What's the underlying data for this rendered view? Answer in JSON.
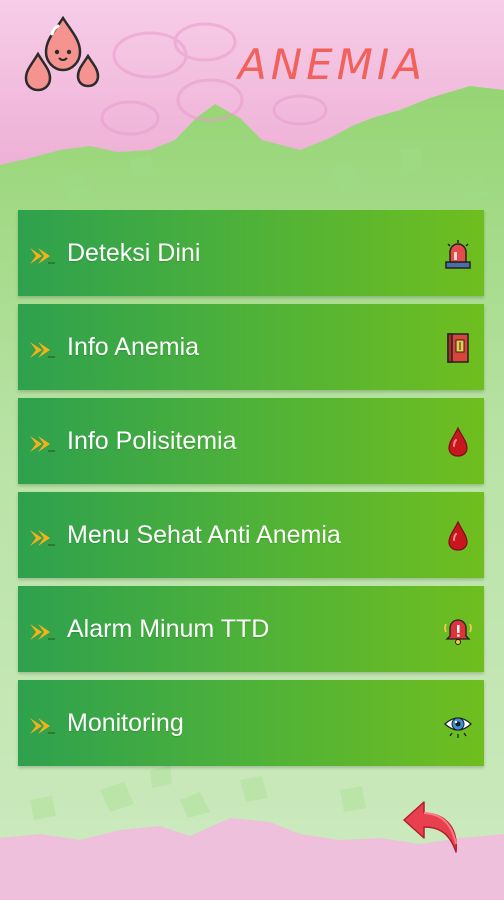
{
  "header": {
    "title": "ANEMIA",
    "logo_icon": "blood-drops-logo-icon"
  },
  "colors": {
    "title": "#f0625b",
    "header_pink": "#f2b6dc",
    "hill_green": "#8fd36a",
    "menu_start": "#2ea14e",
    "menu_end": "#6fbe1f",
    "chevron": "#f6b11a",
    "back_arrow": "#e8404f"
  },
  "menu": {
    "items": [
      {
        "label": "Deteksi Dini",
        "icon": "siren-icon"
      },
      {
        "label": "Info Anemia",
        "icon": "book-icon"
      },
      {
        "label": "Info Polisitemia",
        "icon": "blood-drop-icon"
      },
      {
        "label": "Menu Sehat Anti Anemia",
        "icon": "blood-drop-icon"
      },
      {
        "label": "Alarm Minum TTD",
        "icon": "alarm-bell-icon"
      },
      {
        "label": "Monitoring",
        "icon": "eye-icon"
      }
    ]
  },
  "footer": {
    "back_icon": "back-arrow-icon"
  }
}
